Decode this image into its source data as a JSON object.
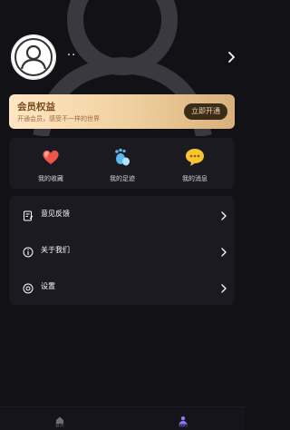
{
  "profile": {
    "nickname": "··"
  },
  "vip": {
    "title": "会员权益",
    "subtitle": "开通会员，感受不一样的世界",
    "button_label": "立即开通"
  },
  "quick_actions": [
    {
      "label": "我的收藏",
      "icon": "hearts-icon"
    },
    {
      "label": "我的足迹",
      "icon": "footprint-icon"
    },
    {
      "label": "我的消息",
      "icon": "message-bubble-icon"
    }
  ],
  "menu": [
    {
      "label": "意见反馈",
      "icon": "feedback-icon"
    },
    {
      "label": "关于我们",
      "icon": "info-icon"
    },
    {
      "label": "设置",
      "icon": "settings-icon"
    }
  ],
  "tabbar": {
    "items": [
      {
        "label": "首页",
        "icon": "home-icon",
        "active": false
      },
      {
        "label": "我的",
        "icon": "user-icon",
        "active": true
      }
    ]
  },
  "colors": {
    "background": "#121116",
    "card": "#1b1a20",
    "vip_gradient_start": "#ffe7c5",
    "vip_gradient_end": "#d9b07b",
    "vip_text": "#7a4a1d",
    "tab_active": "#8b7cf6",
    "tab_inactive": "#6d6c74"
  }
}
